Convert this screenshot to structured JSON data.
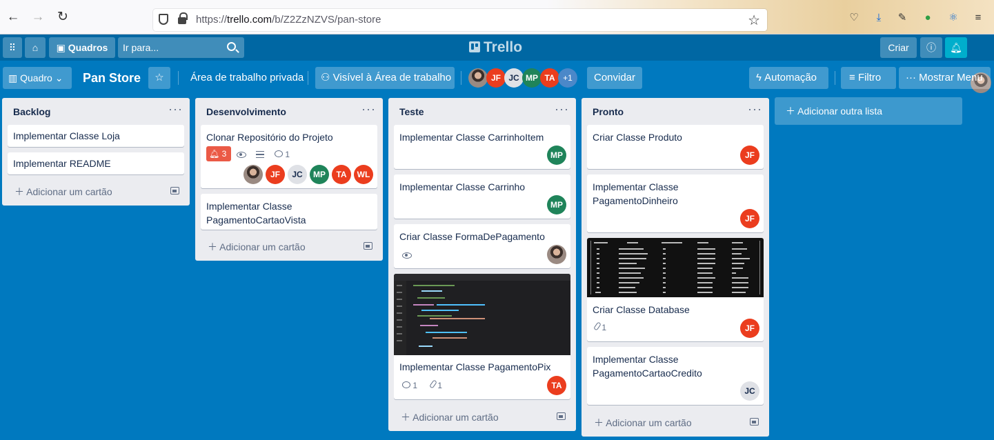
{
  "browser": {
    "url_prefix": "https://",
    "url_domain": "trello.com",
    "url_path": "/b/Z2ZzNZVS/pan-store"
  },
  "header": {
    "boards_label": "Quadros",
    "search_placeholder": "Ir para...",
    "logo": "Trello",
    "create_label": "Criar"
  },
  "board": {
    "view_label": "Quadro",
    "name": "Pan Store",
    "workspace": "Área de trabalho privada",
    "visibility": "Visível à Área de trabalho",
    "members": [
      "JF",
      "JC",
      "MP",
      "TA"
    ],
    "more_members": "+1",
    "invite": "Convidar",
    "automation": "Automação",
    "filter": "Filtro",
    "menu": "Mostrar Menu"
  },
  "add_card_label": "Adicionar um cartão",
  "add_list_label": "Adicionar outra lista",
  "lists": [
    {
      "title": "Backlog",
      "cards": [
        {
          "title": "Implementar Classe Loja"
        },
        {
          "title": "Implementar README"
        }
      ]
    },
    {
      "title": "Desenvolvimento",
      "cards": [
        {
          "title": "Clonar Repositório do Projeto",
          "notifications": "3",
          "comments": "1",
          "members": [
            "JF",
            "JC",
            "MP",
            "TA",
            "WL"
          ]
        },
        {
          "title": "Implementar Classe PagamentoCartaoVista"
        }
      ]
    },
    {
      "title": "Teste",
      "cards": [
        {
          "title": "Implementar Classe CarrinhoItem",
          "members": [
            "MP"
          ]
        },
        {
          "title": "Implementar Classe Carrinho",
          "members": [
            "MP"
          ]
        },
        {
          "title": "Criar Classe FormaDePagamento"
        },
        {
          "title": "Implementar Classe PagamentoPix",
          "comments": "1",
          "attachments": "1",
          "members": [
            "TA"
          ]
        }
      ]
    },
    {
      "title": "Pronto",
      "cards": [
        {
          "title": "Criar Classe Produto",
          "members": [
            "JF"
          ]
        },
        {
          "title": "Implementar Classe PagamentoDinheiro",
          "members": [
            "JF"
          ]
        },
        {
          "title": "Criar Classe Database",
          "attachments": "1",
          "members": [
            "JF"
          ]
        },
        {
          "title": "Implementar Classe PagamentoCartaoCredito",
          "members": [
            "JC"
          ]
        }
      ]
    }
  ],
  "colors": {
    "board_bg": "#0079bf",
    "header_bg": "#0067a3",
    "list_bg": "#ebecf0",
    "red_avatar": "#eb3d1e",
    "green_avatar": "#1f845a",
    "notification_badge": "#eb5a46"
  }
}
